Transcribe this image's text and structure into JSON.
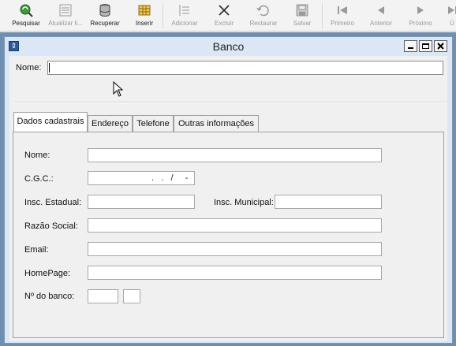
{
  "toolbar": {
    "buttons": [
      {
        "label": "Pesquisar",
        "icon": "search-refresh-icon",
        "enabled": true
      },
      {
        "label": "Atualizar li...",
        "icon": "update-list-icon",
        "enabled": false
      },
      {
        "label": "Recuperar",
        "icon": "database-icon",
        "enabled": true
      },
      {
        "label": "Inserir",
        "icon": "insert-grid-icon",
        "enabled": true
      },
      {
        "label": "Adicionar",
        "icon": "add-lines-icon",
        "enabled": false
      },
      {
        "label": "Excluir",
        "icon": "delete-x-icon",
        "enabled": false
      },
      {
        "label": "Restaurar",
        "icon": "restore-arrow-icon",
        "enabled": false
      },
      {
        "label": "Salvar",
        "icon": "save-disk-icon",
        "enabled": false
      },
      {
        "label": "Primeiro",
        "icon": "first-record-icon",
        "enabled": false
      },
      {
        "label": "Anterior",
        "icon": "previous-record-icon",
        "enabled": false
      },
      {
        "label": "Próximo",
        "icon": "next-record-icon",
        "enabled": false
      },
      {
        "label": "Ú",
        "icon": "last-record-icon",
        "enabled": false
      }
    ]
  },
  "window": {
    "title": "Banco",
    "sys_icon_glyph": "⇕"
  },
  "top": {
    "nome_label": "Nome:",
    "nome_value": ""
  },
  "tabs": [
    {
      "label": "Dados cadastrais",
      "active": true
    },
    {
      "label": "Endereço",
      "active": false
    },
    {
      "label": "Telefone",
      "active": false
    },
    {
      "label": "Outras informações",
      "active": false
    }
  ],
  "form": {
    "nome_label": "Nome:",
    "nome_value": "",
    "cgc_label": "C.G.C.:",
    "cgc_mask": ".   .   /     -",
    "insc_estadual_label": "Insc. Estadual:",
    "insc_estadual_value": "",
    "insc_municipal_label": "Insc. Municipal:",
    "insc_municipal_value": "",
    "razao_label": "Razão Social:",
    "razao_value": "",
    "email_label": "Email:",
    "email_value": "",
    "homepage_label": "HomePage:",
    "homepage_value": "",
    "nbanco_label": "Nº do banco:",
    "nbanco_value": "",
    "nbanco_digit_value": ""
  },
  "colors": {
    "window_frame": "#dbe7f4",
    "mdi_background": "#6e8fb2",
    "accent_blue": "#2a5a9a"
  }
}
